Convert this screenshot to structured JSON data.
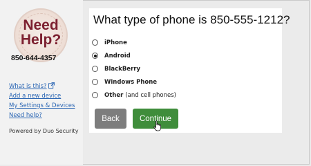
{
  "sidebar": {
    "logo_headline": "Need\nHelp?",
    "logo_phone": "850-644-4357",
    "links": [
      {
        "label": "What is this?",
        "icon": "external-link-icon"
      },
      {
        "label": "Add a new device"
      },
      {
        "label": "My Settings & Devices"
      },
      {
        "label": "Need help?"
      }
    ],
    "powered_by": "Powered by Duo Security"
  },
  "main": {
    "title": "What type of phone is 850-555-1212?",
    "options": [
      {
        "label": "iPhone",
        "note": "",
        "selected": false
      },
      {
        "label": "Android",
        "note": "",
        "selected": true
      },
      {
        "label": "BlackBerry",
        "note": "",
        "selected": false
      },
      {
        "label": "Windows Phone",
        "note": "",
        "selected": false
      },
      {
        "label": "Other",
        "note": "(and cell phones)",
        "selected": false
      }
    ],
    "back_label": "Back",
    "continue_label": "Continue"
  },
  "colors": {
    "link": "#2b66b4",
    "continue_button": "#3f8d3b",
    "back_button": "#7d7d7d",
    "logo_text": "#7c2030"
  }
}
